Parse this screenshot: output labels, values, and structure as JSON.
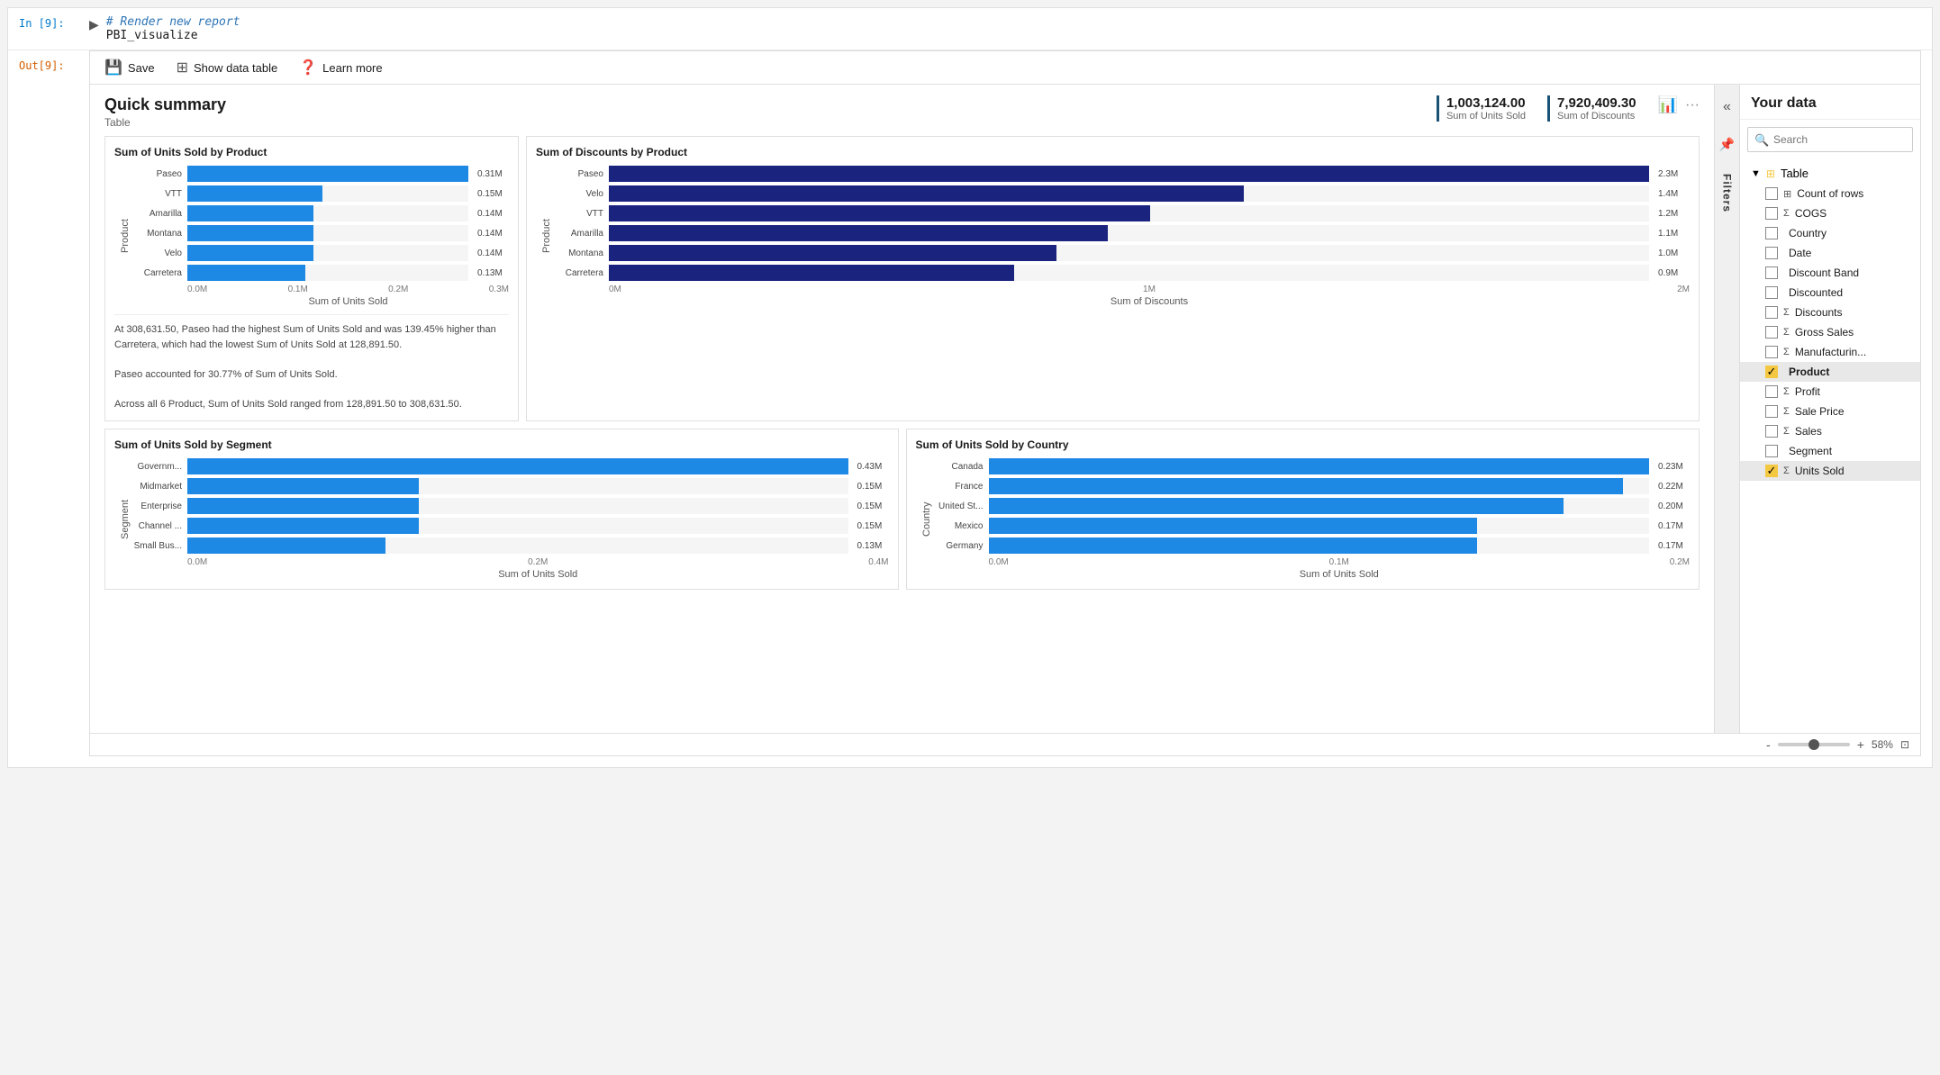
{
  "cell_input": {
    "label": "In [9]:",
    "code_comment": "# Render new report",
    "code_fn": "PBI_visualize"
  },
  "cell_output": {
    "label": "Out[9]:"
  },
  "toolbar": {
    "save_label": "Save",
    "show_data_table_label": "Show data table",
    "learn_more_label": "Learn more"
  },
  "quick_summary": {
    "title": "Quick summary",
    "subtitle": "Table",
    "stat1_value": "1,003,124.00",
    "stat1_label": "Sum of Units Sold",
    "stat2_value": "7,920,409.30",
    "stat2_label": "Sum of Discounts"
  },
  "chart1": {
    "title": "Sum of Units Sold by Product",
    "y_axis_label": "Product",
    "x_axis_label": "Sum of Units Sold",
    "x_ticks": [
      "0.0M",
      "0.1M",
      "0.2M",
      "0.3M"
    ],
    "bars": [
      {
        "label": "Paseo",
        "value": "0.31M",
        "pct": 100
      },
      {
        "label": "VTT",
        "value": "0.15M",
        "pct": 48
      },
      {
        "label": "Amarilla",
        "value": "0.14M",
        "pct": 45
      },
      {
        "label": "Montana",
        "value": "0.14M",
        "pct": 45
      },
      {
        "label": "Velo",
        "value": "0.14M",
        "pct": 45
      },
      {
        "label": "Carretera",
        "value": "0.13M",
        "pct": 42
      }
    ],
    "description1": "At 308,631.50, Paseo had the highest Sum of Units Sold and was 139.45% higher than Carretera, which had the lowest Sum of Units Sold at 128,891.50.",
    "description2": "Paseo accounted for 30.77% of Sum of Units Sold.",
    "description3": "Across all 6 Product, Sum of Units Sold ranged from 128,891.50 to 308,631.50."
  },
  "chart2": {
    "title": "Sum of Discounts by Product",
    "y_axis_label": "Product",
    "x_axis_label": "Sum of Discounts",
    "x_ticks": [
      "0M",
      "1M",
      "2M"
    ],
    "bars": [
      {
        "label": "Paseo",
        "value": "2.3M",
        "pct": 100
      },
      {
        "label": "Velo",
        "value": "1.4M",
        "pct": 61
      },
      {
        "label": "VTT",
        "value": "1.2M",
        "pct": 52
      },
      {
        "label": "Amarilla",
        "value": "1.1M",
        "pct": 48
      },
      {
        "label": "Montana",
        "value": "1.0M",
        "pct": 43
      },
      {
        "label": "Carretera",
        "value": "0.9M",
        "pct": 39
      }
    ]
  },
  "chart3": {
    "title": "Sum of Units Sold by Segment",
    "y_axis_label": "Segment",
    "x_axis_label": "Sum of Units Sold",
    "x_ticks": [
      "0.0M",
      "0.2M",
      "0.4M"
    ],
    "bars": [
      {
        "label": "Governm...",
        "value": "0.43M",
        "pct": 100
      },
      {
        "label": "Midmarket",
        "value": "0.15M",
        "pct": 35
      },
      {
        "label": "Enterprise",
        "value": "0.15M",
        "pct": 35
      },
      {
        "label": "Channel ...",
        "value": "0.15M",
        "pct": 35
      },
      {
        "label": "Small Bus...",
        "value": "0.13M",
        "pct": 30
      }
    ]
  },
  "chart4": {
    "title": "Sum of Units Sold by Country",
    "y_axis_label": "Country",
    "x_axis_label": "Sum of Units Sold",
    "x_ticks": [
      "0.0M",
      "0.1M",
      "0.2M"
    ],
    "bars": [
      {
        "label": "Canada",
        "value": "0.23M",
        "pct": 100
      },
      {
        "label": "France",
        "value": "0.22M",
        "pct": 96
      },
      {
        "label": "United St...",
        "value": "0.20M",
        "pct": 87
      },
      {
        "label": "Mexico",
        "value": "0.17M",
        "pct": 74
      },
      {
        "label": "Germany",
        "value": "0.17M",
        "pct": 74
      }
    ]
  },
  "filters": {
    "label": "Filters"
  },
  "data_panel": {
    "title": "Your data",
    "search_placeholder": "Search",
    "table_label": "Table",
    "items": [
      {
        "label": "Count of rows",
        "icon": "grid",
        "checked": false,
        "sigma": false
      },
      {
        "label": "COGS",
        "icon": "sigma",
        "checked": false,
        "sigma": true
      },
      {
        "label": "Country",
        "icon": "field",
        "checked": false,
        "sigma": false
      },
      {
        "label": "Date",
        "icon": "field",
        "checked": false,
        "sigma": false
      },
      {
        "label": "Discount Band",
        "icon": "field",
        "checked": false,
        "sigma": false
      },
      {
        "label": "Discounted",
        "icon": "field",
        "checked": false,
        "sigma": false
      },
      {
        "label": "Discounts",
        "icon": "sigma",
        "checked": false,
        "sigma": true
      },
      {
        "label": "Gross Sales",
        "icon": "sigma",
        "checked": false,
        "sigma": true
      },
      {
        "label": "Manufacturin...",
        "icon": "sigma",
        "checked": false,
        "sigma": true
      },
      {
        "label": "Product",
        "icon": "field",
        "checked": true,
        "sigma": false,
        "selected": true
      },
      {
        "label": "Profit",
        "icon": "sigma",
        "checked": false,
        "sigma": true
      },
      {
        "label": "Sale Price",
        "icon": "sigma",
        "checked": false,
        "sigma": true
      },
      {
        "label": "Sales",
        "icon": "sigma",
        "checked": false,
        "sigma": true
      },
      {
        "label": "Segment",
        "icon": "field",
        "checked": false,
        "sigma": false
      },
      {
        "label": "Units Sold",
        "icon": "sigma",
        "checked": true,
        "sigma": true,
        "selected": true
      }
    ]
  },
  "bottom_bar": {
    "zoom_label": "58%",
    "minus_label": "-",
    "plus_label": "+"
  }
}
